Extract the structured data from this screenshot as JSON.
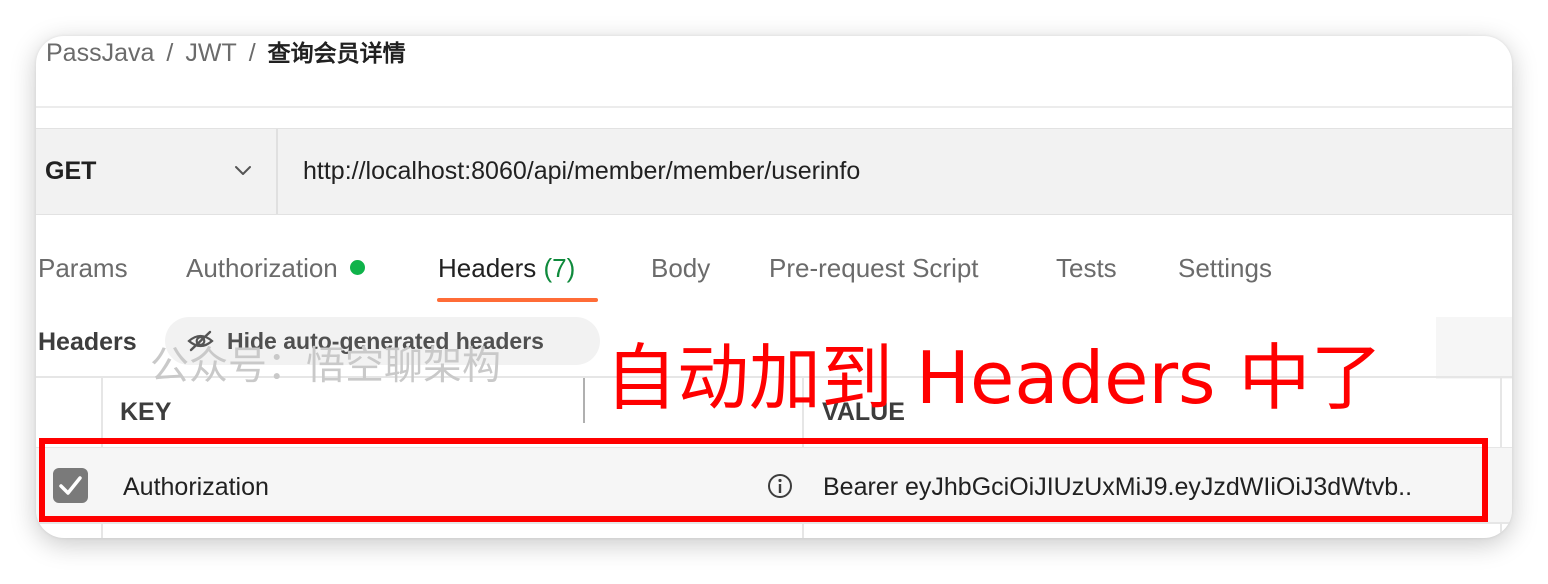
{
  "breadcrumb": {
    "items": [
      "PassJava",
      "JWT"
    ],
    "separator": "/",
    "current": "查询会员详情"
  },
  "request": {
    "method": "GET",
    "url": "http://localhost:8060/api/member/member/userinfo"
  },
  "tabs": [
    {
      "label": "Params"
    },
    {
      "label": "Authorization",
      "status_dot": "green"
    },
    {
      "label": "Headers",
      "count": "(7)",
      "active": true
    },
    {
      "label": "Body"
    },
    {
      "label": "Pre-request Script"
    },
    {
      "label": "Tests"
    },
    {
      "label": "Settings"
    }
  ],
  "headers_section": {
    "title": "Headers",
    "toggle_label": "Hide auto-generated headers",
    "toggle_icon": "eye-off-icon"
  },
  "table": {
    "columns": [
      "KEY",
      "VALUE"
    ],
    "rows": [
      {
        "checked": true,
        "key": "Authorization",
        "value": "Bearer eyJhbGciOiJIUzUxMiJ9.eyJzdWIiOiJ3dWtvb.."
      }
    ]
  },
  "watermark": "公众号：悟空聊架构",
  "annotation": "自动加到 Headers 中了",
  "colors": {
    "accent": "#ff6c37",
    "annotation": "#ff0000",
    "status_green": "#0fb34a",
    "count_green": "#0f8a3c"
  }
}
